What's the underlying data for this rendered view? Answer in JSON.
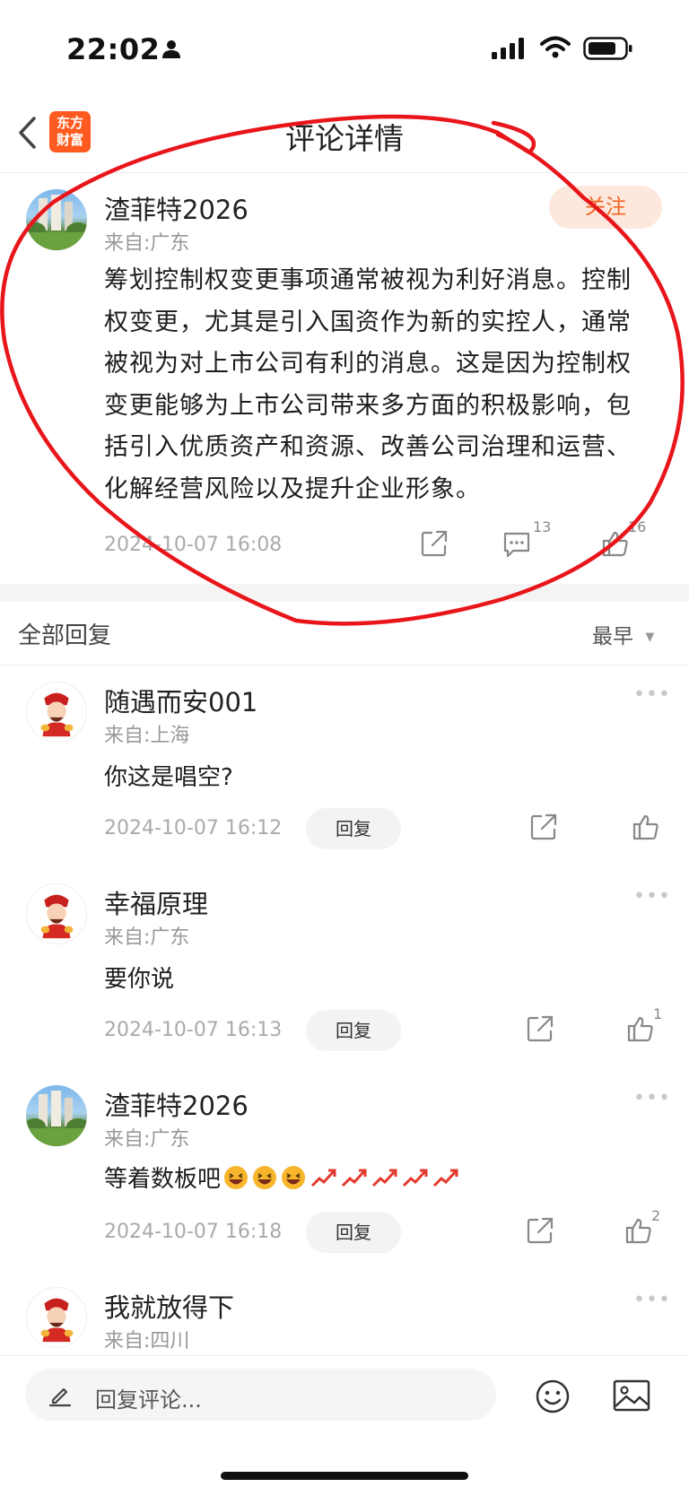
{
  "status_bar": {
    "time": "22:02"
  },
  "header": {
    "logo_line1": "东方",
    "logo_line2": "财富",
    "title": "评论详情"
  },
  "post": {
    "username": "渣菲特2026",
    "location": "来自:广东",
    "follow_label": "关注",
    "lines": [
      "筹划控制权变更事项通常被视为利好消息。控制",
      "权变更，尤其是引入国资作为新的实控人，通常",
      "被视为对上市公司有利的消息。这是因为控制权",
      "变更能够为上市公司带来多方面的积极影响，包",
      "括引入优质资产和资源、改善公司治理和运营、",
      "化解经营风险以及提升企业形象。"
    ],
    "timestamp": "2024-10-07 16:08",
    "comment_count": "13",
    "like_count": "16"
  },
  "replies_header": {
    "title": "全部回复",
    "sort_label": "最早",
    "sort_arrow": "▼"
  },
  "replies": [
    {
      "username": "随遇而安001",
      "location": "来自:上海",
      "text": "你这是唱空?",
      "timestamp": "2024-10-07 16:12",
      "reply_label": "回复",
      "like_count": ""
    },
    {
      "username": "幸福原理",
      "location": "来自:广东",
      "text": "要你说",
      "timestamp": "2024-10-07 16:13",
      "reply_label": "回复",
      "like_count": "1"
    },
    {
      "username": "渣菲特2026",
      "location": "来自:广东",
      "text": "等着数板吧",
      "timestamp": "2024-10-07 16:18",
      "reply_label": "回复",
      "like_count": "2"
    },
    {
      "username": "我就放得下",
      "location": "来自:四川"
    }
  ],
  "input_bar": {
    "placeholder": "回复评论..."
  },
  "annotation_color": "#e8161b"
}
